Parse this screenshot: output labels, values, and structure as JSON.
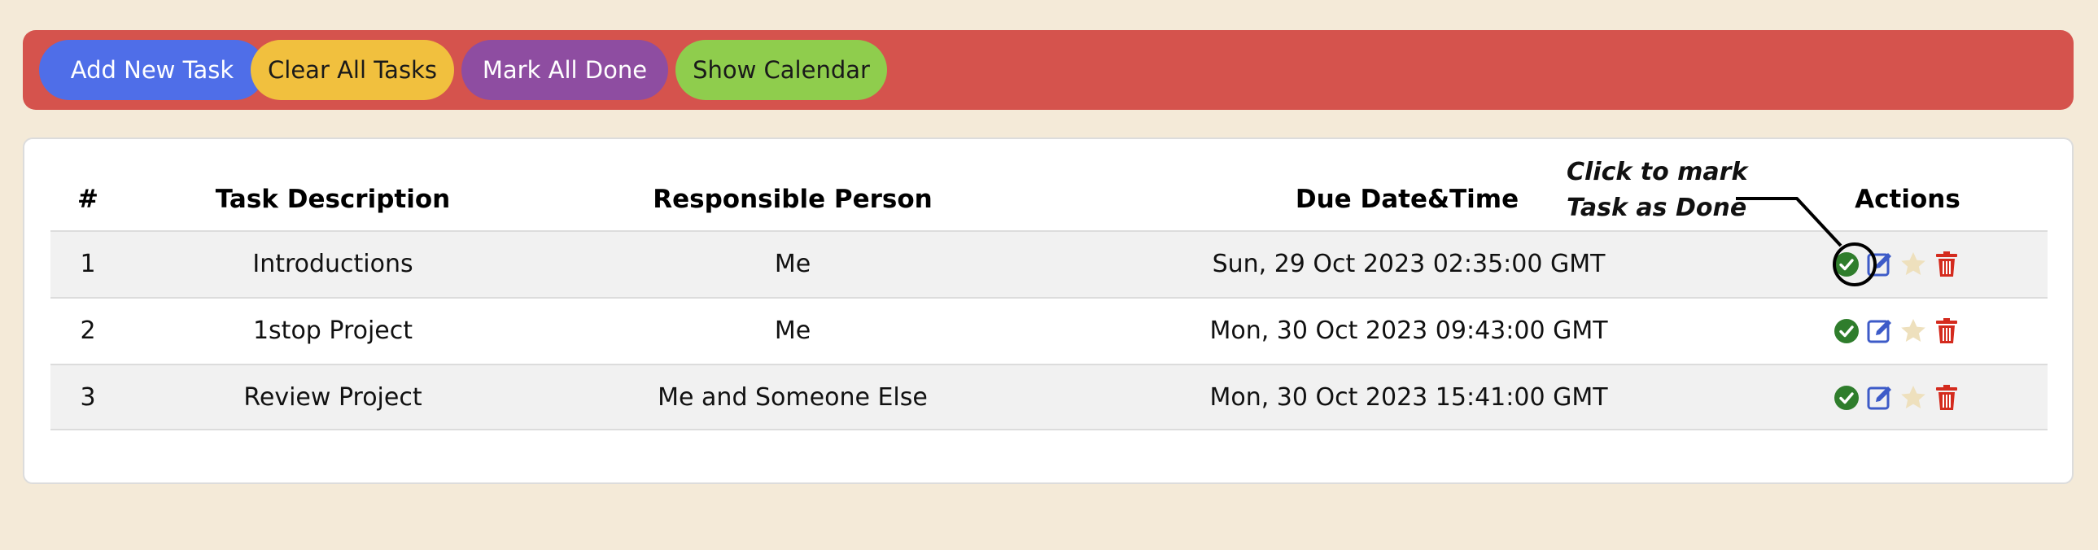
{
  "toolbar": {
    "add_label": "Add New Task",
    "clear_label": "Clear All Tasks",
    "mark_done_label": "Mark All Done",
    "calendar_label": "Show Calendar"
  },
  "table": {
    "headers": {
      "index": "#",
      "description": "Task Description",
      "person": "Responsible Person",
      "due": "Due Date&Time",
      "actions": "Actions"
    },
    "rows": [
      {
        "index": "1",
        "description": "Introductions",
        "person": "Me",
        "due": "Sun, 29 Oct 2023 02:35:00 GMT"
      },
      {
        "index": "2",
        "description": "1stop Project",
        "person": "Me",
        "due": "Mon, 30 Oct 2023 09:43:00 GMT"
      },
      {
        "index": "3",
        "description": "Review Project",
        "person": "Me and Someone Else",
        "due": "Mon, 30 Oct 2023 15:41:00 GMT"
      }
    ]
  },
  "annotation": {
    "line1": "Click to mark",
    "line2": "Task as Done"
  },
  "icons": {
    "done": "check-circle-icon",
    "edit": "edit-icon",
    "favorite": "star-icon",
    "delete": "trash-icon"
  },
  "colors": {
    "toolbar": "#d5534d",
    "add_button": "#4f6ee8",
    "clear_button": "#f1c03e",
    "mark_done_button": "#8e4da1",
    "calendar_button": "#8fcd4d",
    "done_icon": "#2f7d2c",
    "edit_icon": "#3d5bc8",
    "star_icon": "#eee0bd",
    "delete_icon": "#d42b1e",
    "background": "#f4ead8"
  }
}
